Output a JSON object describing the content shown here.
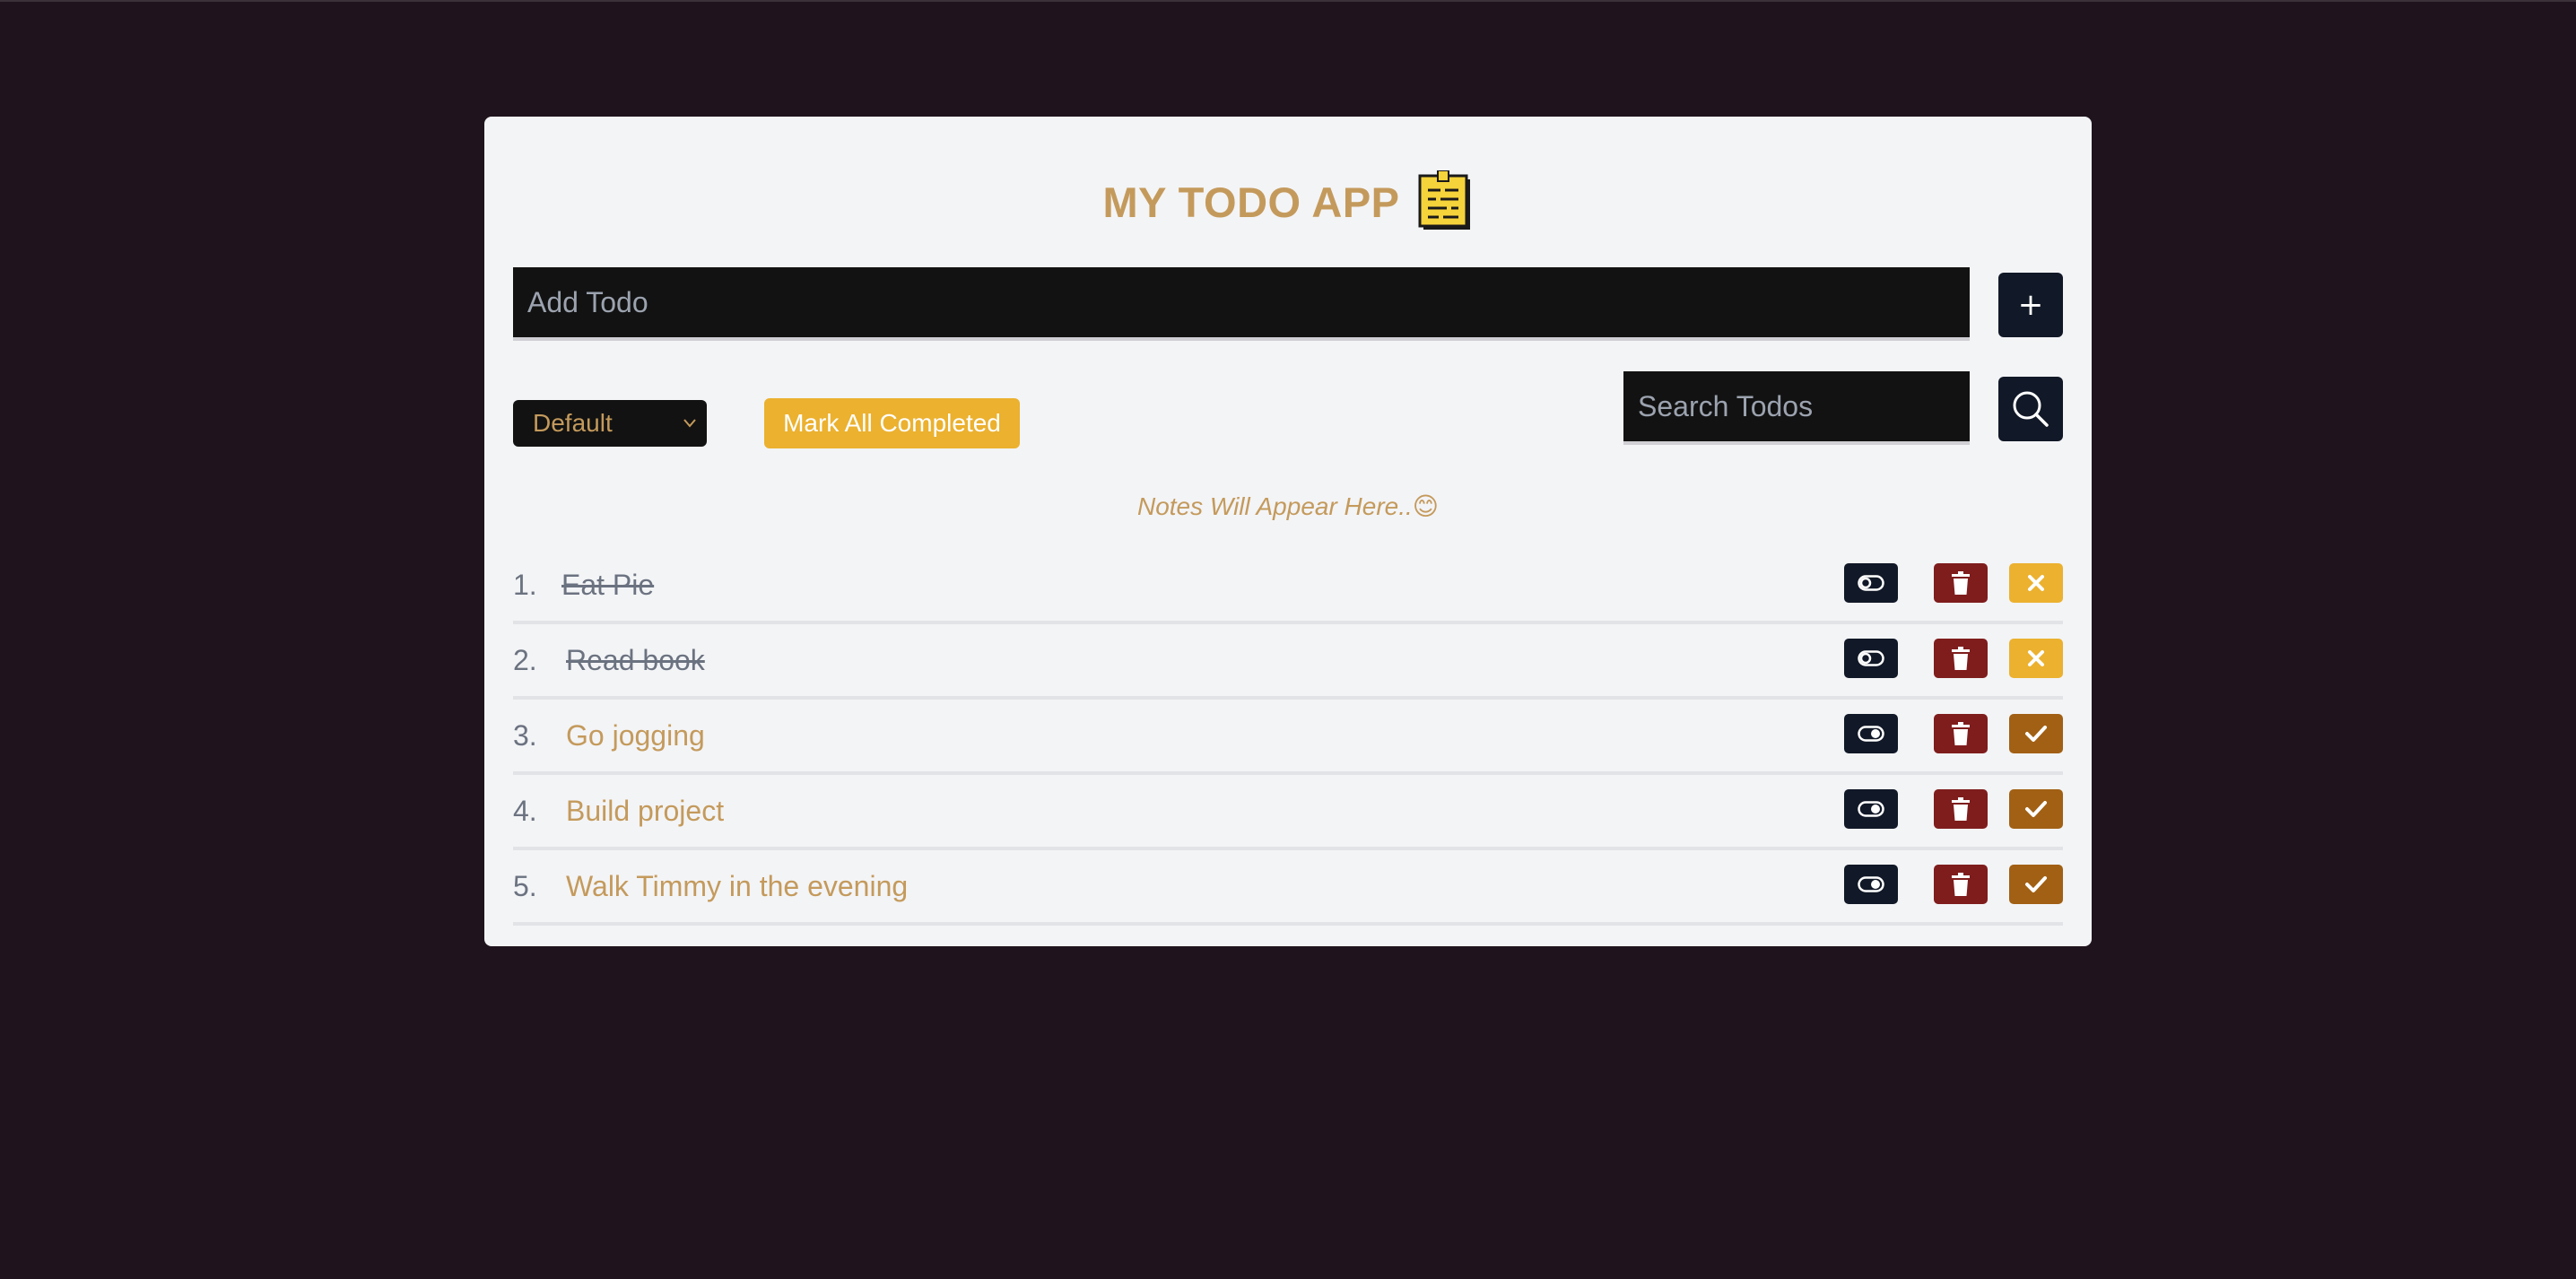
{
  "app": {
    "title": "MY TODO APP",
    "title_icon": "memo-icon"
  },
  "add": {
    "placeholder": "Add Todo",
    "button_label": "+"
  },
  "filter": {
    "selected": "Default",
    "options": [
      "Default"
    ]
  },
  "mark_all": {
    "label": "Mark All Completed"
  },
  "search": {
    "placeholder": "Search Todos",
    "icon": "search-icon"
  },
  "notes": {
    "text": "Notes Will Appear Here..😊"
  },
  "todos": [
    {
      "num": "1.",
      "text": "Eat Pie",
      "completed": true
    },
    {
      "num": "2.",
      "text": "Read book",
      "completed": true
    },
    {
      "num": "3.",
      "text": "Go jogging",
      "completed": false
    },
    {
      "num": "4.",
      "text": "Build project",
      "completed": false
    },
    {
      "num": "5.",
      "text": "Walk Timmy in the evening",
      "completed": false
    }
  ],
  "colors": {
    "background": "#1f141d",
    "card": "#f3f4f6",
    "accent": "#c49a5c",
    "yellow": "#ebb12f",
    "dark": "#111827",
    "danger": "#7f1d1d",
    "check": "#a16014"
  }
}
